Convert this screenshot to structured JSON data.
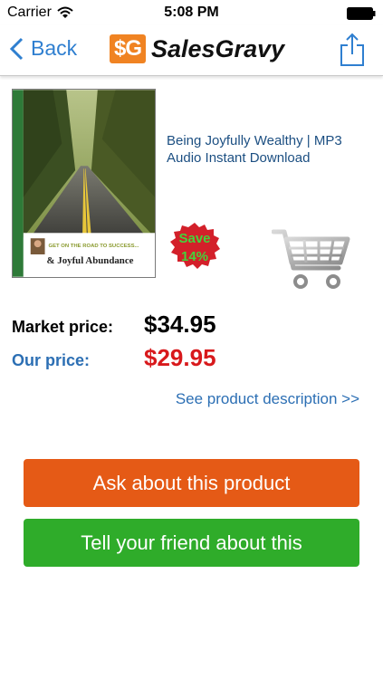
{
  "status_bar": {
    "carrier": "Carrier",
    "time": "5:08 PM"
  },
  "nav": {
    "back_label": "Back",
    "logo_mark": "$G",
    "logo_text": "SalesGravy"
  },
  "product": {
    "title": "Being Joyfully Wealthy | MP3 Audio Instant Download",
    "cover_tagline": "GET ON THE ROAD TO SUCCESS...",
    "cover_title": "& Joyful Abundance"
  },
  "save_badge": {
    "line1": "Save",
    "line2": "14%"
  },
  "pricing": {
    "market_label": "Market price:",
    "market_value": "$34.95",
    "our_label": "Our price:",
    "our_value": "$29.95"
  },
  "description_link": "See product description >>",
  "buttons": {
    "ask": "Ask about this product",
    "tell": "Tell your friend about this"
  },
  "colors": {
    "accent_blue": "#2f7fd0",
    "ask_orange": "#e55a16",
    "tell_green": "#2fac2a",
    "price_red": "#d8191c",
    "logo_orange": "#f08322"
  }
}
